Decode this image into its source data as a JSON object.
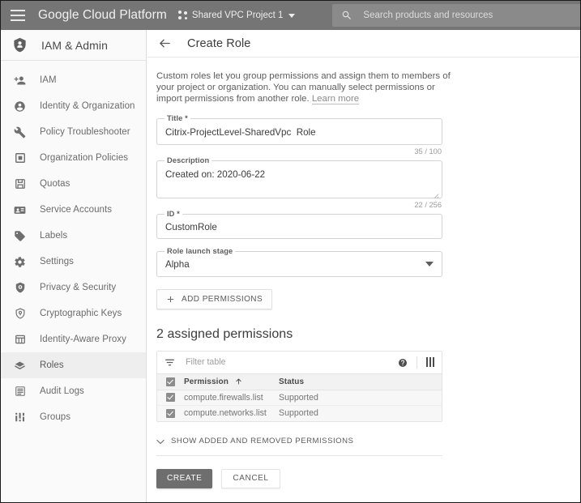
{
  "topbar": {
    "menu_icon": "hamburger-menu-icon",
    "brand": "Google Cloud Platform",
    "project_icon": "project-dots-icon",
    "project_name": "Shared VPC Project 1",
    "project_caret": "chevron-down-icon",
    "search_icon": "search-icon",
    "search_placeholder": "Search products and resources",
    "search_caret": "chevron-down-icon",
    "bg_color": "#757575",
    "search_bg_color": "#8a8a8a"
  },
  "sidebar": {
    "header": {
      "icon": "shield-person-icon",
      "title": "IAM & Admin"
    },
    "items": [
      {
        "label": "IAM",
        "icon": "person-add-icon",
        "active": false
      },
      {
        "label": "Identity & Organization",
        "icon": "person-circle-icon",
        "active": false
      },
      {
        "label": "Policy Troubleshooter",
        "icon": "wrench-icon",
        "active": false
      },
      {
        "label": "Organization Policies",
        "icon": "square-outline-icon",
        "active": false
      },
      {
        "label": "Quotas",
        "icon": "save-disk-icon",
        "active": false
      },
      {
        "label": "Service Accounts",
        "icon": "id-card-icon",
        "active": false
      },
      {
        "label": "Labels",
        "icon": "tag-icon",
        "active": false
      },
      {
        "label": "Settings",
        "icon": "gear-icon",
        "active": false
      },
      {
        "label": "Privacy & Security",
        "icon": "shield-lock-icon",
        "active": false
      },
      {
        "label": "Cryptographic Keys",
        "icon": "key-shield-icon",
        "active": false
      },
      {
        "label": "Identity-Aware Proxy",
        "icon": "proxy-grid-icon",
        "active": false
      },
      {
        "label": "Roles",
        "icon": "roles-layers-icon",
        "active": true
      },
      {
        "label": "Audit Logs",
        "icon": "lines-list-icon",
        "active": false
      },
      {
        "label": "Groups",
        "icon": "groups-bars-icon",
        "active": false
      }
    ]
  },
  "page": {
    "back_icon": "back-arrow-icon",
    "title": "Create Role",
    "intro_text": "Custom roles let you group permissions and assign them to members of your project or organization. You can manually select permissions or import permissions from another role.",
    "intro_link": "Learn more"
  },
  "form": {
    "title_field": {
      "label": "Title *",
      "value": "Citrix-ProjectLevel-SharedVpc  Role",
      "counter": "35 / 100"
    },
    "description_field": {
      "label": "Description",
      "value": "Created on: 2020-06-22",
      "counter": "22 / 256"
    },
    "id_field": {
      "label": "ID *",
      "value": "CustomRole"
    },
    "launch_stage_field": {
      "label": "Role launch stage",
      "value": "Alpha",
      "caret_icon": "chevron-down-icon"
    },
    "add_permissions_button": {
      "label": "ADD PERMISSIONS",
      "icon": "plus-icon"
    }
  },
  "permissions": {
    "section_title": "2 assigned permissions",
    "toolbar": {
      "filter_icon": "filter-list-icon",
      "filter_placeholder": "Filter table",
      "help_icon": "help-circle-icon",
      "columns_icon": "column-settings-icon"
    },
    "columns": [
      "Permission",
      "Status"
    ],
    "sort_icon": "sort-arrow-up-icon",
    "header_checkbox_icon": "checkbox-checked-icon",
    "rows": [
      {
        "checked": true,
        "permission": "compute.firewalls.list",
        "status": "Supported"
      },
      {
        "checked": true,
        "permission": "compute.networks.list",
        "status": "Supported"
      }
    ]
  },
  "footer": {
    "expander": {
      "icon": "chevron-down-icon",
      "label": "SHOW ADDED AND REMOVED PERMISSIONS"
    },
    "create_label": "CREATE",
    "cancel_label": "CANCEL",
    "create_bg_color": "#6e6e6e"
  }
}
